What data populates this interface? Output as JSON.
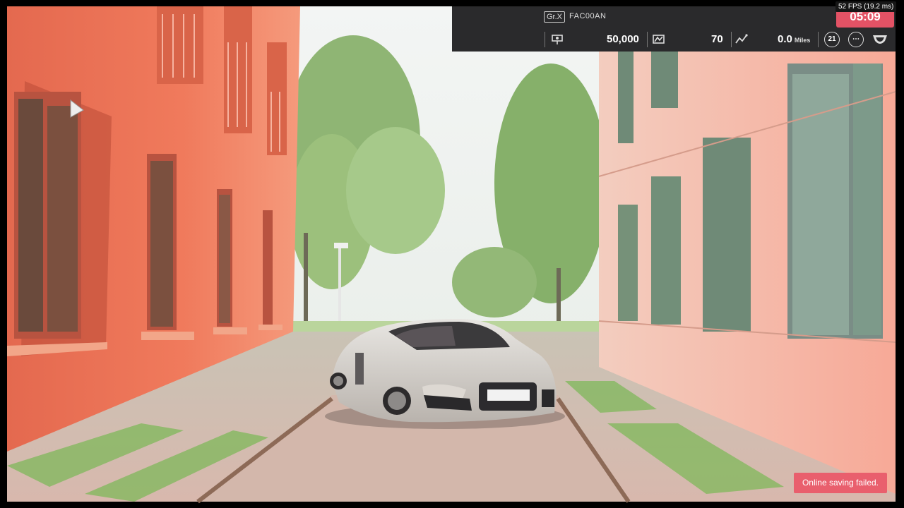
{
  "hud": {
    "badge": "Gr.X",
    "plate": "FAC00AN",
    "timer": "05:09",
    "stats": {
      "credits": "50,000",
      "level": "70",
      "distance": "0.0",
      "distance_unit": "Miles",
      "rank": "21"
    }
  },
  "fps": "52 FPS (19.2 ms)",
  "toast": "Online saving failed.",
  "icons": [
    "credits-icon",
    "level-icon",
    "distance-icon",
    "rank-icon",
    "menu-icon",
    "emblem-icon"
  ],
  "colors": {
    "hud_bg": "#2a2a2c",
    "timer_bg": "#e35265",
    "toast_bg": "#e95f6d"
  }
}
